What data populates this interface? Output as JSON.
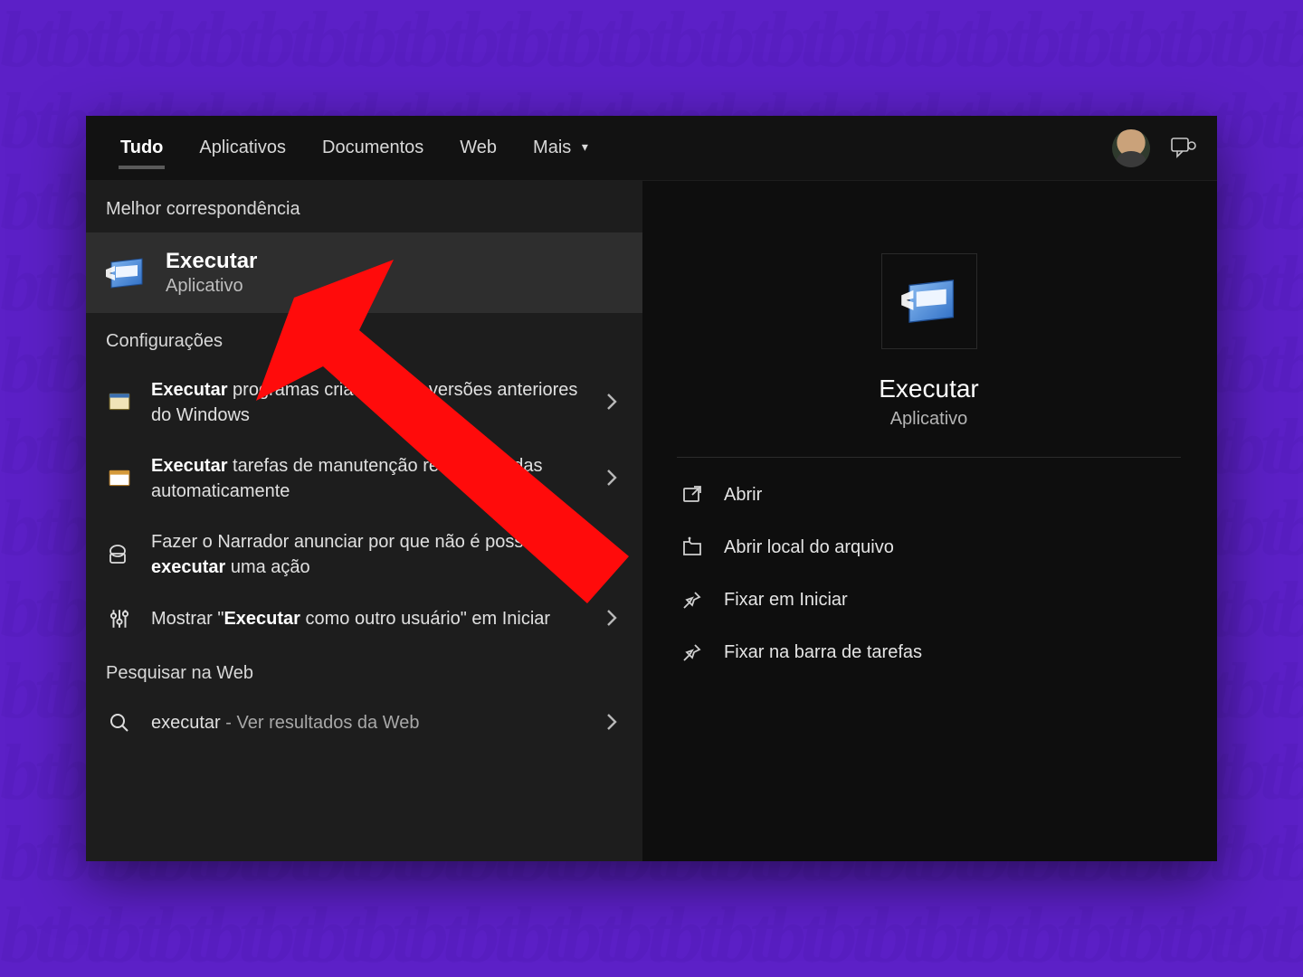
{
  "bg_pattern_unit": "bt",
  "tabs": {
    "all": "Tudo",
    "apps": "Aplicativos",
    "docs": "Documentos",
    "web": "Web",
    "more": "Mais"
  },
  "left": {
    "best_match_label": "Melhor correspondência",
    "best_match": {
      "title": "Executar",
      "subtitle": "Aplicativo"
    },
    "settings_label": "Configurações",
    "settings_items": [
      {
        "before": "",
        "bold": "Executar",
        "after": " programas criados para versões anteriores do Windows",
        "icon": "window-legacy"
      },
      {
        "before": "",
        "bold": "Executar",
        "after": " tarefas de manutenção recomendadas automaticamente",
        "icon": "window-flag"
      },
      {
        "before": "Fazer o Narrador anunciar por que não é possível ",
        "bold": "executar",
        "after": " uma ação",
        "icon": "narrator"
      },
      {
        "before": "Mostrar \"",
        "bold": "Executar",
        "after": " como outro usuário\" em Iniciar",
        "icon": "sliders"
      }
    ],
    "web_label": "Pesquisar na Web",
    "web_item": {
      "query": "executar",
      "suffix": " - Ver resultados da Web"
    }
  },
  "right": {
    "title": "Executar",
    "subtitle": "Aplicativo",
    "actions": [
      {
        "label": "Abrir",
        "icon": "open"
      },
      {
        "label": "Abrir local do arquivo",
        "icon": "folder-location"
      },
      {
        "label": "Fixar em Iniciar",
        "icon": "pin"
      },
      {
        "label": "Fixar na barra de tarefas",
        "icon": "pin"
      }
    ]
  }
}
